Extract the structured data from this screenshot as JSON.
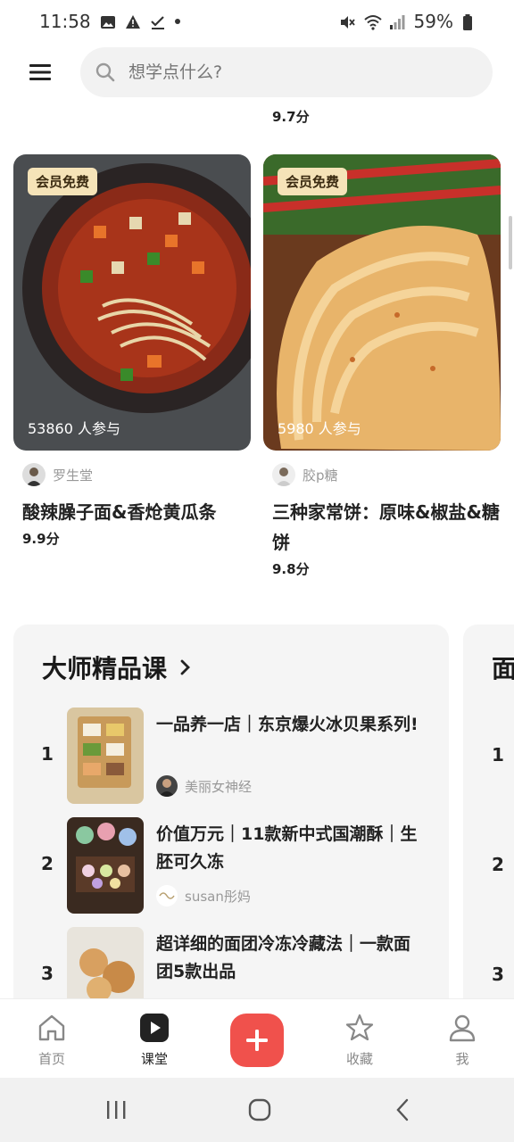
{
  "status_bar": {
    "time": "11:58",
    "battery": "59%"
  },
  "search": {
    "placeholder": "想学点什么?"
  },
  "previous_score": "9.7分",
  "cards": [
    {
      "badge": "会员免费",
      "participants": "53860 人参与",
      "author": "罗生堂",
      "title": "酸辣臊子面&香炝黄瓜条",
      "score": "9.9分"
    },
    {
      "badge": "会员免费",
      "participants": "5980 人参与",
      "author": "胶p糖",
      "title": "三种家常饼：原味&椒盐&糖饼",
      "score": "9.8分"
    }
  ],
  "master_panel": {
    "title": "大师精品课",
    "courses": [
      {
        "rank": "1",
        "title": "一品养一店｜东京爆火冰贝果系列!",
        "author": "美丽女神经"
      },
      {
        "rank": "2",
        "title": "价值万元｜11款新中式国潮酥｜生胚可久冻",
        "author": "susan彤妈"
      },
      {
        "rank": "3",
        "title": "超详细的面团冷冻冷藏法｜一款面团5款出品",
        "author": ""
      }
    ]
  },
  "peek_panel": {
    "title": "面",
    "ranks": [
      "1",
      "2",
      "3"
    ]
  },
  "tabs": [
    {
      "label": "首页",
      "icon": "home-icon"
    },
    {
      "label": "课堂",
      "icon": "play-icon"
    },
    {
      "label": "收藏",
      "icon": "star-icon"
    },
    {
      "label": "我",
      "icon": "person-icon"
    }
  ],
  "colors": {
    "accent": "#f0514c",
    "badge_bg": "#f5e3b8",
    "panel_bg": "#f5f5f5"
  }
}
